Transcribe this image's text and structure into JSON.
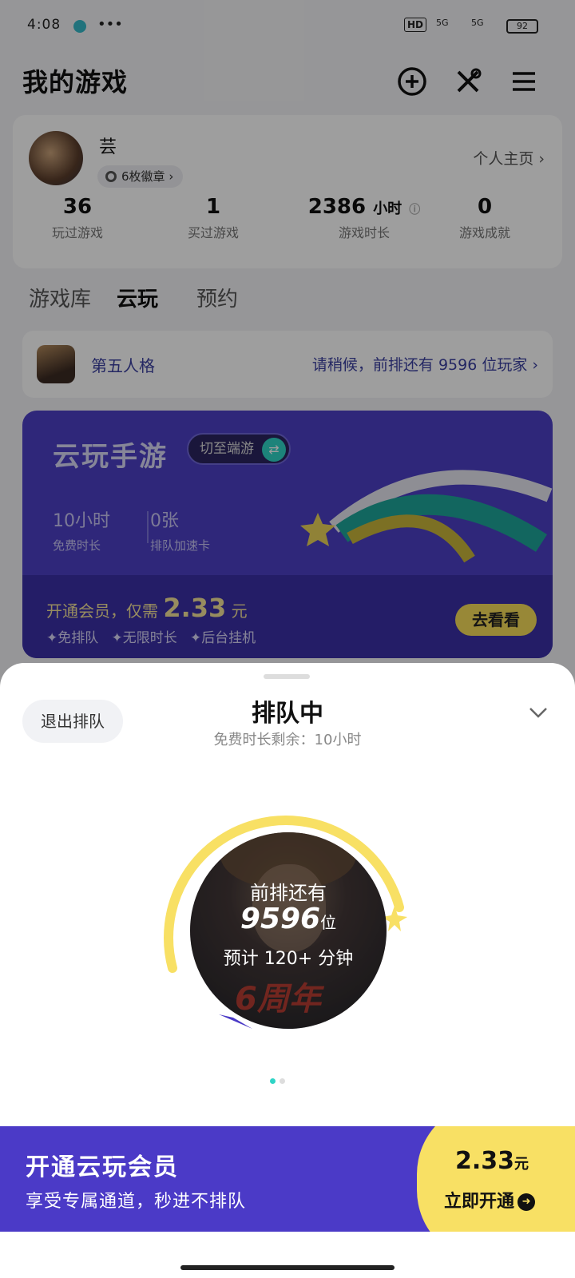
{
  "status_bar": {
    "time": "4:08",
    "dots": "•••",
    "hd": "HD",
    "signal1": "5G",
    "signal2": "5G",
    "battery": "92"
  },
  "header": {
    "title": "我的游戏"
  },
  "profile": {
    "username": "芸",
    "badges": "6枚徽章",
    "homepage": "个人主页",
    "stats": [
      {
        "value": "36",
        "unit": "",
        "label": "玩过游戏"
      },
      {
        "value": "1",
        "unit": "",
        "label": "买过游戏"
      },
      {
        "value": "2386",
        "unit": "小时",
        "label": "游戏时长"
      },
      {
        "value": "0",
        "unit": "",
        "label": "游戏成就"
      }
    ]
  },
  "tabs": [
    "游戏库",
    "云玩",
    "预约"
  ],
  "queue_row": {
    "game": "第五人格",
    "message": "请稍候，前排还有 9596 位玩家"
  },
  "promo": {
    "title": "云玩手游",
    "switch_label": "切至端游",
    "stat1_value": "10小时",
    "stat1_label": "免费时长",
    "stat2_value": "0张",
    "stat2_label": "排队加速卡",
    "offer_prefix": "开通会员，仅需",
    "offer_price": "2.33",
    "offer_unit": "元",
    "perks": [
      "免排队",
      "无限时长",
      "后台挂机"
    ],
    "go_button": "去看看"
  },
  "sheet": {
    "exit_button": "退出排队",
    "title": "排队中",
    "subtitle": "免费时长剩余：10小时",
    "ahead_label": "前排还有",
    "ahead_count": "9596",
    "ahead_unit": "位",
    "eta": "预计 120+ 分钟",
    "anniversary": "6周年"
  },
  "member_bar": {
    "title": "开通云玩会员",
    "subtitle": "享受专属通道，秒进不排队",
    "price": "2.33",
    "price_unit": "元",
    "open_label": "立即开通"
  },
  "colors": {
    "accent": "#4b3ac7",
    "teal": "#2fd4c6",
    "yellow": "#f8e064"
  }
}
